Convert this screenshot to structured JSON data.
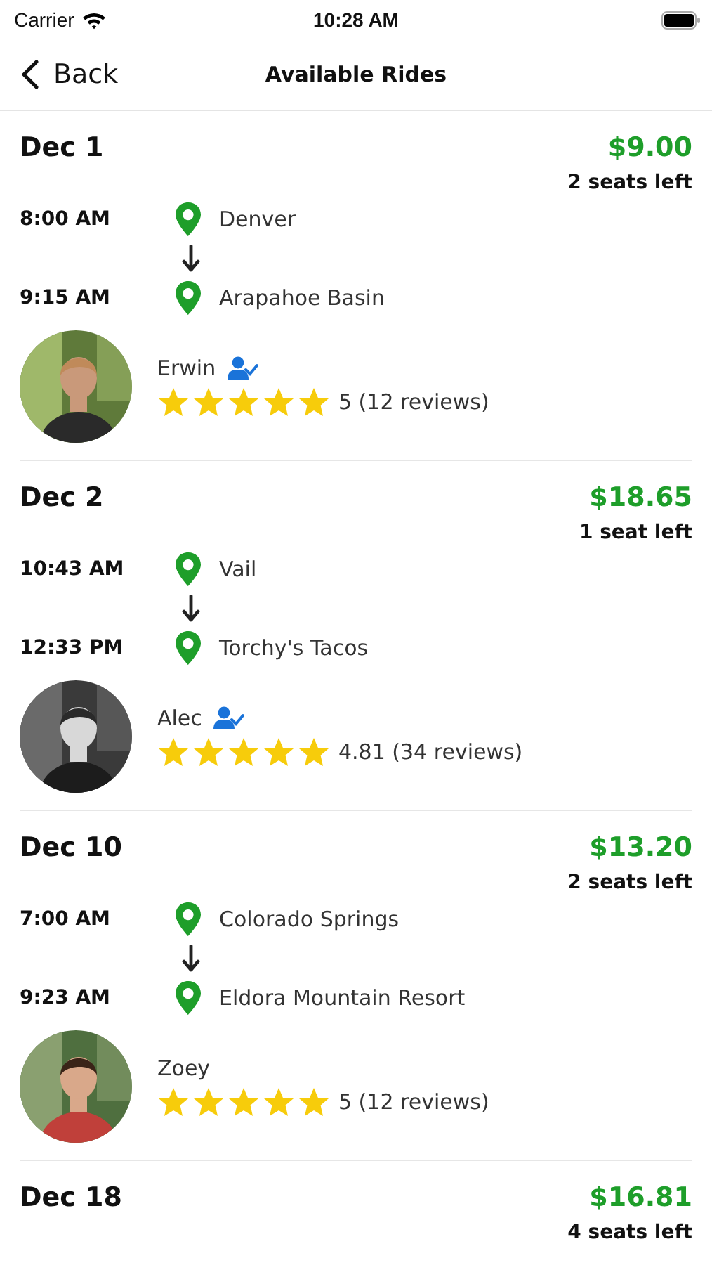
{
  "status_bar": {
    "carrier": "Carrier",
    "time": "10:28 AM"
  },
  "nav": {
    "back": "Back",
    "title": "Available Rides"
  },
  "rides": [
    {
      "date": "Dec 1",
      "price": "$9.00",
      "seats": "2 seats left",
      "departure_time": "8:00 AM",
      "origin": "Denver",
      "arrival_time": "9:15 AM",
      "destination": "Arapahoe Basin",
      "driver": "Erwin",
      "verified": true,
      "stars": 5,
      "rating": "5 (12 reviews)"
    },
    {
      "date": "Dec 2",
      "price": "$18.65",
      "seats": "1 seat left",
      "departure_time": "10:43 AM",
      "origin": "Vail",
      "arrival_time": "12:33 PM",
      "destination": "Torchy's Tacos",
      "driver": "Alec",
      "verified": true,
      "stars": 5,
      "rating": "4.81 (34 reviews)"
    },
    {
      "date": "Dec 10",
      "price": "$13.20",
      "seats": "2 seats left",
      "departure_time": "7:00 AM",
      "origin": "Colorado Springs",
      "arrival_time": "9:23 AM",
      "destination": "Eldora Mountain Resort",
      "driver": "Zoey",
      "verified": false,
      "stars": 5,
      "rating": "5 (12 reviews)"
    },
    {
      "date": "Dec 18",
      "price": "$16.81",
      "seats": "4 seats left"
    }
  ]
}
